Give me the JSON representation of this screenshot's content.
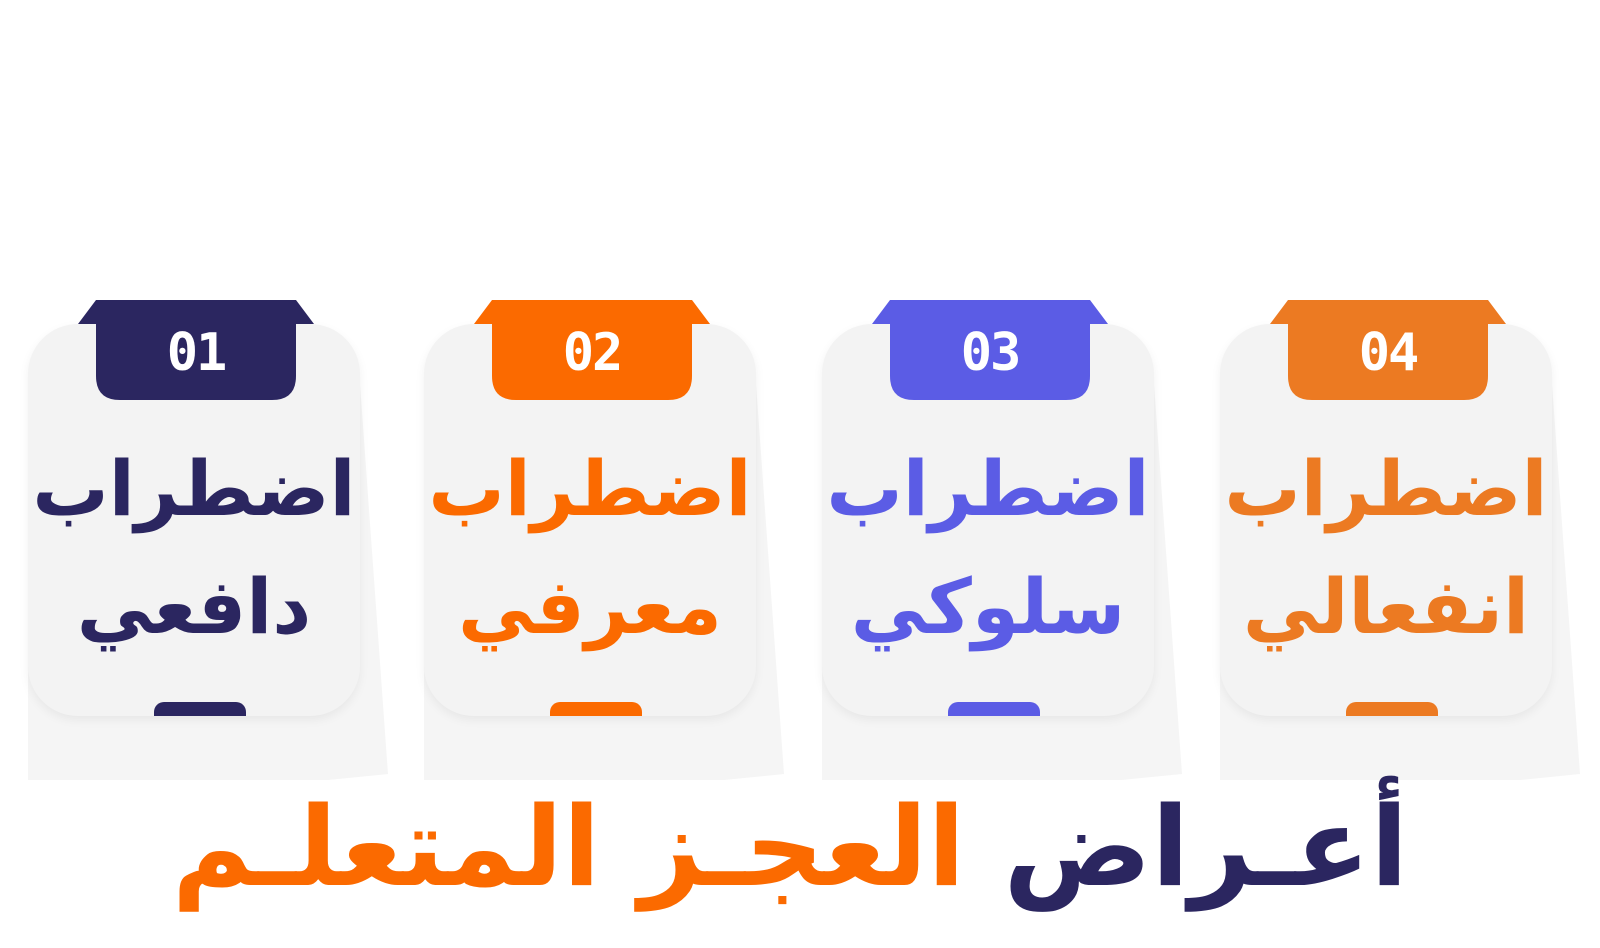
{
  "colors": {
    "navy": "#2b2660",
    "orange": "#fb6a00",
    "violet": "#5b5ce5",
    "amber": "#ec7a22",
    "card_bg": "#f3f3f3"
  },
  "cards": [
    {
      "number": "01",
      "line1": "اضطراب",
      "line2": "دافعي",
      "color": "#2b2660"
    },
    {
      "number": "02",
      "line1": "اضطراب",
      "line2": "معرفي",
      "color": "#fb6a00"
    },
    {
      "number": "03",
      "line1": "اضطراب",
      "line2": "سلوكي",
      "color": "#5b5ce5"
    },
    {
      "number": "04",
      "line1": "اضطراب",
      "line2": "انفعالي",
      "color": "#ec7a22"
    }
  ],
  "title": {
    "word1": "أعـراض",
    "word2": "العجـز",
    "word3": "المتعلـم",
    "word1_color": "#2b2660",
    "rest_color": "#fb6a00"
  }
}
